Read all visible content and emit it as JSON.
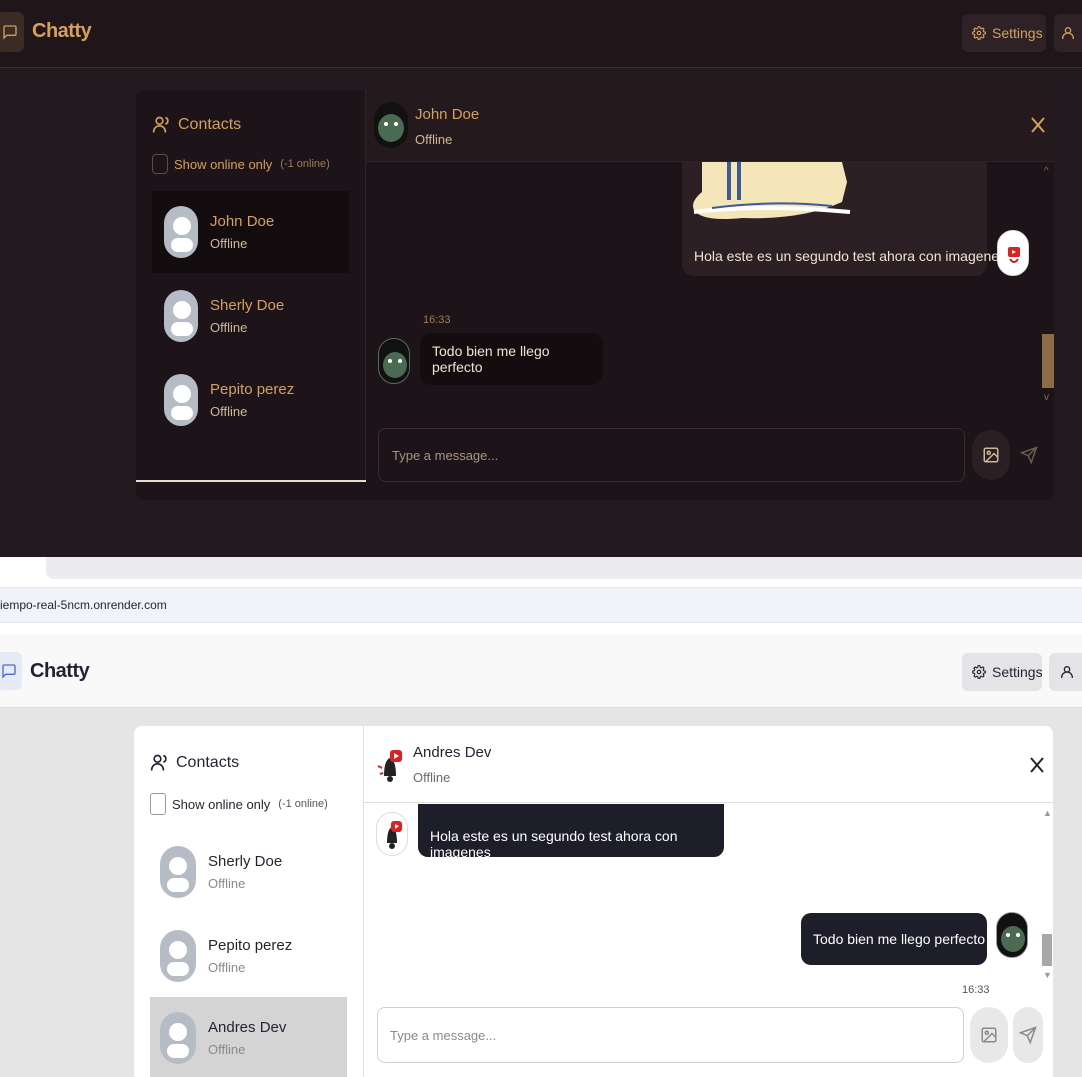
{
  "dark_app": {
    "brand": "Chatty",
    "settings_label": "Settings",
    "sidebar": {
      "title": "Contacts",
      "online_toggle_label": "Show online only",
      "online_count": "(-1 online)",
      "contacts": [
        {
          "name": "John Doe",
          "status": "Offline",
          "active": true
        },
        {
          "name": "Sherly Doe",
          "status": "Offline",
          "active": false
        },
        {
          "name": "Pepito perez",
          "status": "Offline",
          "active": false
        }
      ]
    },
    "chat": {
      "contact_name": "John Doe",
      "contact_status": "Offline",
      "sent_message": "Hola este es un segundo test ahora con imagenes",
      "received_time": "16:33",
      "received_message": "Todo bien me llego perfecto",
      "input_placeholder": "Type a message..."
    },
    "colors": {
      "background": "#221a1e",
      "accent": "#d3a05e"
    }
  },
  "browser": {
    "url": "iempo-real-5ncm.onrender.com"
  },
  "light_app": {
    "brand": "Chatty",
    "settings_label": "Settings",
    "sidebar": {
      "title": "Contacts",
      "online_toggle_label": "Show online only",
      "online_count": "(-1 online)",
      "contacts": [
        {
          "name": "Sherly Doe",
          "status": "Offline",
          "active": false
        },
        {
          "name": "Pepito perez",
          "status": "Offline",
          "active": false
        },
        {
          "name": "Andres Dev",
          "status": "Offline",
          "active": true
        }
      ]
    },
    "chat": {
      "contact_name": "Andres Dev",
      "contact_status": "Offline",
      "received_message": "Hola este es un segundo test ahora con imagenes",
      "sent_time": "16:33",
      "sent_message": "Todo bien me llego perfecto",
      "input_placeholder": "Type a message..."
    },
    "colors": {
      "background": "#ffffff",
      "accent": "#1e1e2a"
    }
  }
}
